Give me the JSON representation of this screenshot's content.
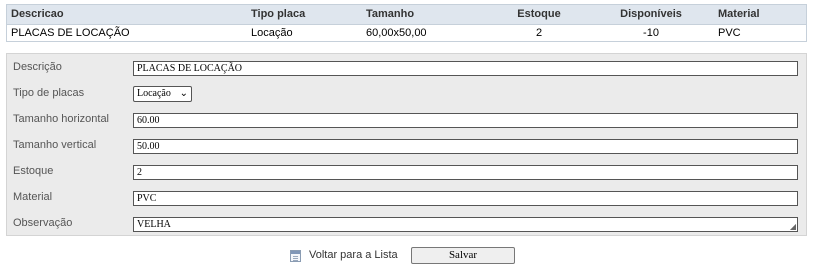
{
  "summary": {
    "headers": [
      "Descricao",
      "Tipo placa",
      "Tamanho",
      "Estoque",
      "Disponíveis",
      "Material"
    ],
    "row": [
      "PLACAS DE LOCAÇÃO",
      "Locação",
      "60,00x50,00",
      "2",
      "-10",
      "PVC"
    ]
  },
  "form": {
    "descricao": {
      "label": "Descrição",
      "value": "PLACAS DE LOCAÇÃO"
    },
    "tipo": {
      "label": "Tipo de placas",
      "selected": "Locação"
    },
    "tam_h": {
      "label": "Tamanho horizontal",
      "value": "60.00"
    },
    "tam_v": {
      "label": "Tamanho vertical",
      "value": "50.00"
    },
    "estoque": {
      "label": "Estoque",
      "value": "2"
    },
    "material": {
      "label": "Material",
      "value": "PVC"
    },
    "observacao": {
      "label": "Observação",
      "value": "VELHA"
    }
  },
  "footer": {
    "back_label": "Voltar para a Lista",
    "save_label": "Salvar"
  },
  "icons": {
    "back": "list-icon",
    "select_chevron": "chevron-down-icon",
    "resize": "resize-grip-icon"
  }
}
